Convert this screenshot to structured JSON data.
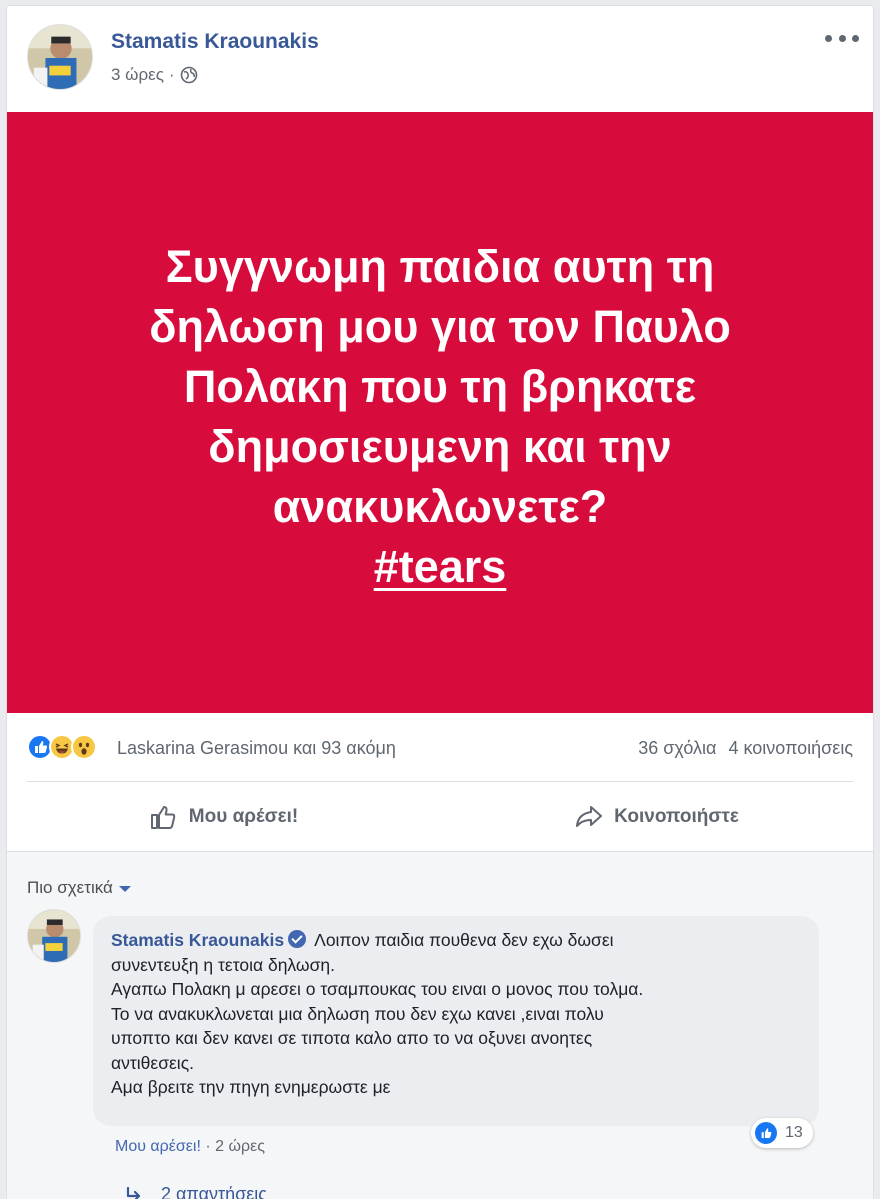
{
  "post": {
    "author": "Stamatis Kraounakis",
    "time": "3 ώρες",
    "separator": "·",
    "privacy_icon": "globe-icon",
    "banner": {
      "background": "#d80c3c",
      "lines": [
        "Συγγνωμη παιδια αυτη τη",
        "δηλωση μου για τον Παυλο",
        "Πολακη που τη βρηκατε",
        "δημοσιευμενη και την",
        "ανακυκλωνετε?"
      ],
      "hashtag": "#tears"
    }
  },
  "reactions": {
    "icons": [
      "like-reaction-icon",
      "haha-reaction-icon",
      "wow-reaction-icon"
    ],
    "summary": "Laskarina Gerasimou και 93 ακόμη",
    "comments": "36 σχόλια",
    "shares": "4 κοινοποιήσεις"
  },
  "actions": {
    "like_label": "Μου αρέσει!",
    "share_label": "Κοινοποιήστε"
  },
  "comments": {
    "sort_label": "Πιο σχετικά",
    "items": [
      {
        "author": "Stamatis Kraounakis",
        "verified": true,
        "lines": [
          "Λοιπον παιδια πουθενα δεν εχω δωσει",
          "συνεντευξη η τετοια δηλωση.",
          "Αγαπω Πολακη μ αρεσει ο τσαμπουκας του ειναι ο μονος που τολμα.",
          "Το να ανακυκλωνεται μια δηλωση που δεν εχω κανει ,ειναι πολυ",
          "υποπτο και δεν κανει σε τιποτα καλο απο το να οξυνει ανοητες",
          "αντιθεσεις.",
          "Αμα βρειτε την πηγη ενημερωστε με"
        ],
        "like_link": "Μου αρέσει!",
        "separator": "·",
        "time": "2 ώρες",
        "like_count": "13",
        "replies_label": "2 απαντήσεις"
      }
    ]
  },
  "colors": {
    "link_blue": "#385898",
    "facebook_blue": "#4267b2",
    "banner_red": "#d80c3c"
  }
}
